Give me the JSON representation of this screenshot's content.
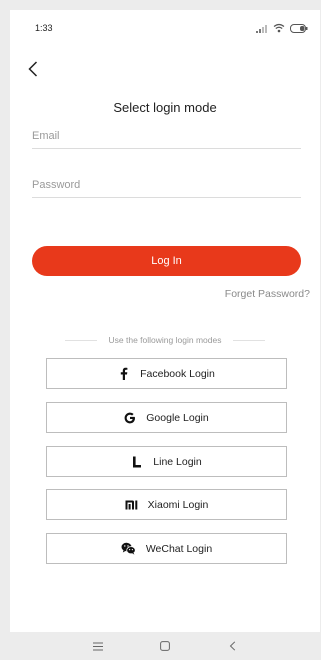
{
  "status_bar": {
    "time": "1:33",
    "icons": [
      "signal-icon",
      "wifi-icon",
      "battery-icon"
    ]
  },
  "header": {
    "back_icon": "chevron-left-icon",
    "title": "Select login mode"
  },
  "form": {
    "email_placeholder": "Email",
    "password_placeholder": "Password",
    "login_label": "Log In",
    "forget_label": "Forget Password?"
  },
  "alternatives": {
    "divider_text": "Use the following login modes",
    "buttons": [
      {
        "icon": "facebook-icon",
        "label": "Facebook Login"
      },
      {
        "icon": "google-icon",
        "label": "Google Login"
      },
      {
        "icon": "line-icon",
        "label": "Line Login"
      },
      {
        "icon": "xiaomi-icon",
        "label": "Xiaomi Login"
      },
      {
        "icon": "wechat-icon",
        "label": "WeChat Login"
      }
    ]
  },
  "navigation": {
    "icons": [
      "menu-icon",
      "home-icon",
      "back-icon"
    ]
  },
  "colors": {
    "accent": "#e8391b",
    "text": "#222222",
    "muted": "#9a9a9a"
  }
}
